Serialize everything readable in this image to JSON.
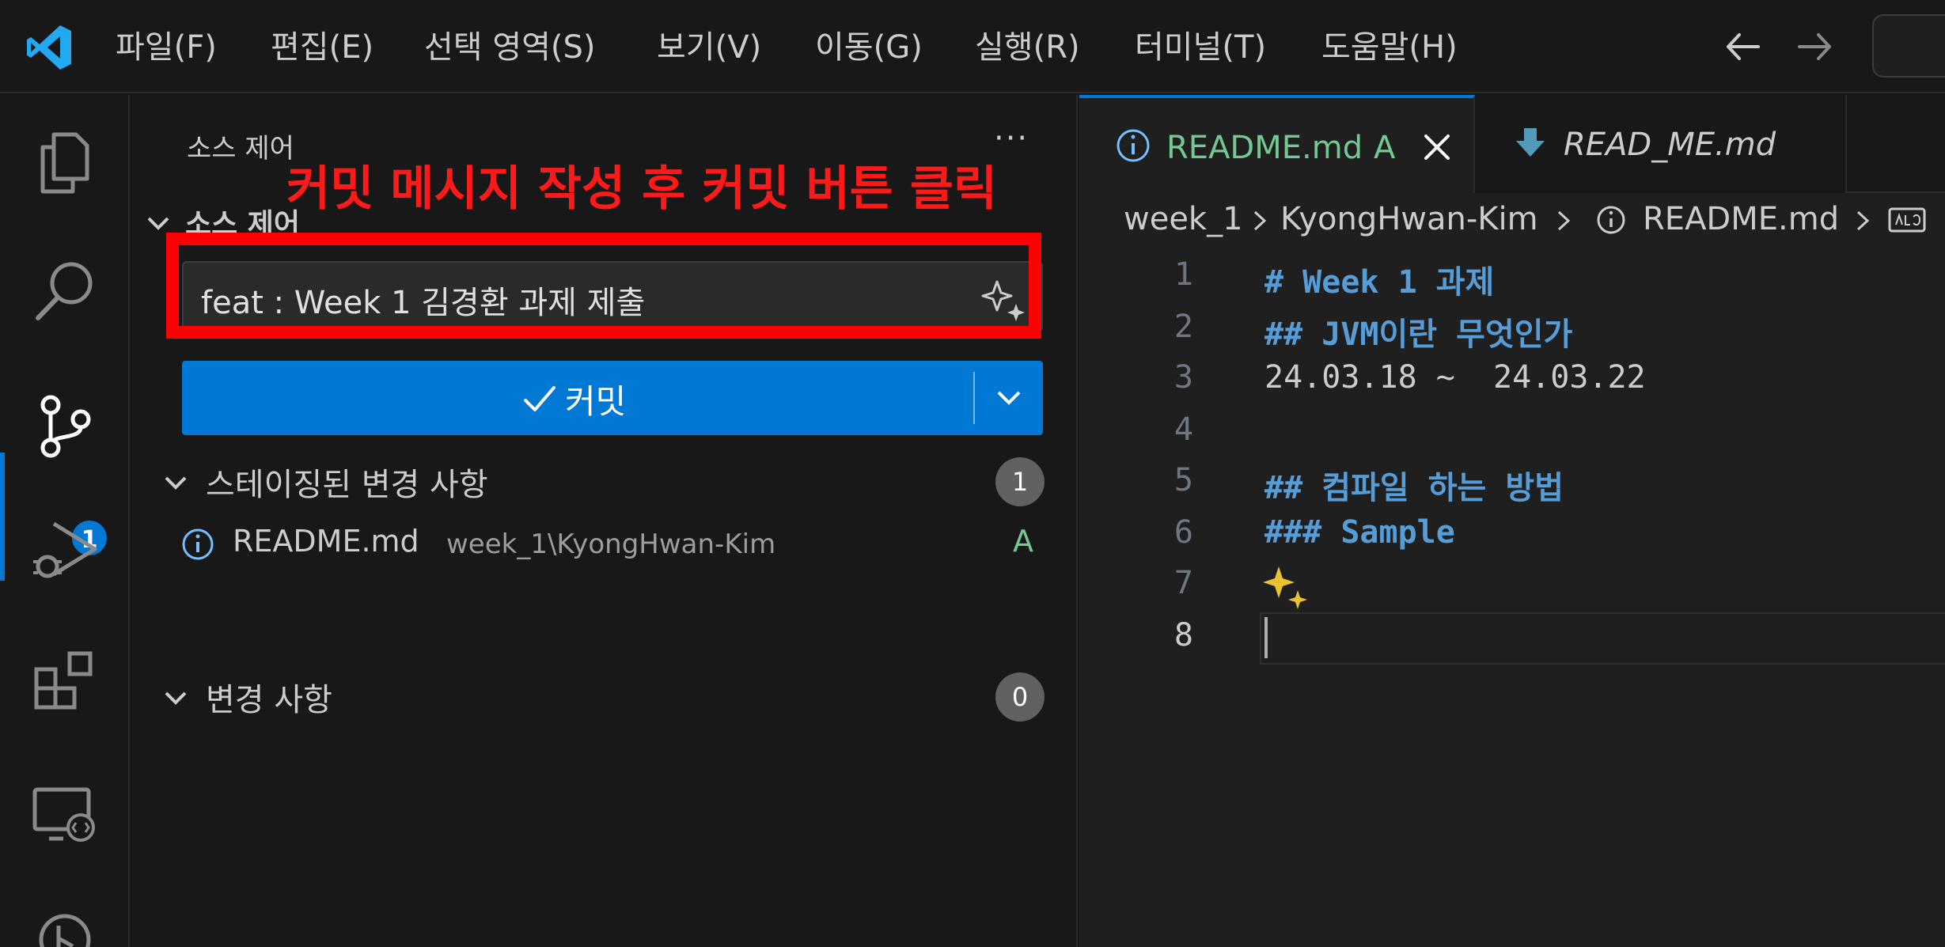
{
  "menu": {
    "items": [
      "파일(F)",
      "편집(E)",
      "선택 영역(S)",
      "보기(V)",
      "이동(G)",
      "실행(R)",
      "터미널(T)",
      "도움말(H)"
    ]
  },
  "activity_bar": {
    "scm_badge": "1"
  },
  "sidebar": {
    "title": "소스 제어",
    "more_label": "···",
    "section_title": "소스 제어",
    "commit_message": "feat : Week 1 김경환 과제 제출",
    "commit_button_label": "커밋",
    "staged_label": "스테이징된 변경 사항",
    "staged_count": "1",
    "staged_files": [
      {
        "name": "README.md",
        "path": "week_1\\KyongHwan-Kim",
        "status": "A"
      }
    ],
    "changes_label": "변경 사항",
    "changes_count": "0"
  },
  "annotation": {
    "instruction": "커밋 메시지 작성 후 커밋 버튼 클릭",
    "color": "#ff0000"
  },
  "editor": {
    "tabs": [
      {
        "name": "README.md",
        "status": "A",
        "active": true
      },
      {
        "name": "READ_ME.md",
        "active": false
      }
    ],
    "breadcrumb": [
      "week_1",
      "KyongHwan-Kim",
      "README.md"
    ],
    "lines": [
      {
        "num": "1",
        "text": "# Week 1 과제"
      },
      {
        "num": "2",
        "text": "## JVM이란 무엇인가"
      },
      {
        "num": "3",
        "text": "24.03.18 ~  24.03.22"
      },
      {
        "num": "4",
        "text": ""
      },
      {
        "num": "5",
        "text": "## 컴파일 하는 방법"
      },
      {
        "num": "6",
        "text": "### Sample"
      },
      {
        "num": "7",
        "text": ""
      },
      {
        "num": "8",
        "text": ""
      }
    ]
  },
  "colors": {
    "accent": "#0078d4",
    "added": "#73c991",
    "markdown_heading": "#569cd6"
  }
}
